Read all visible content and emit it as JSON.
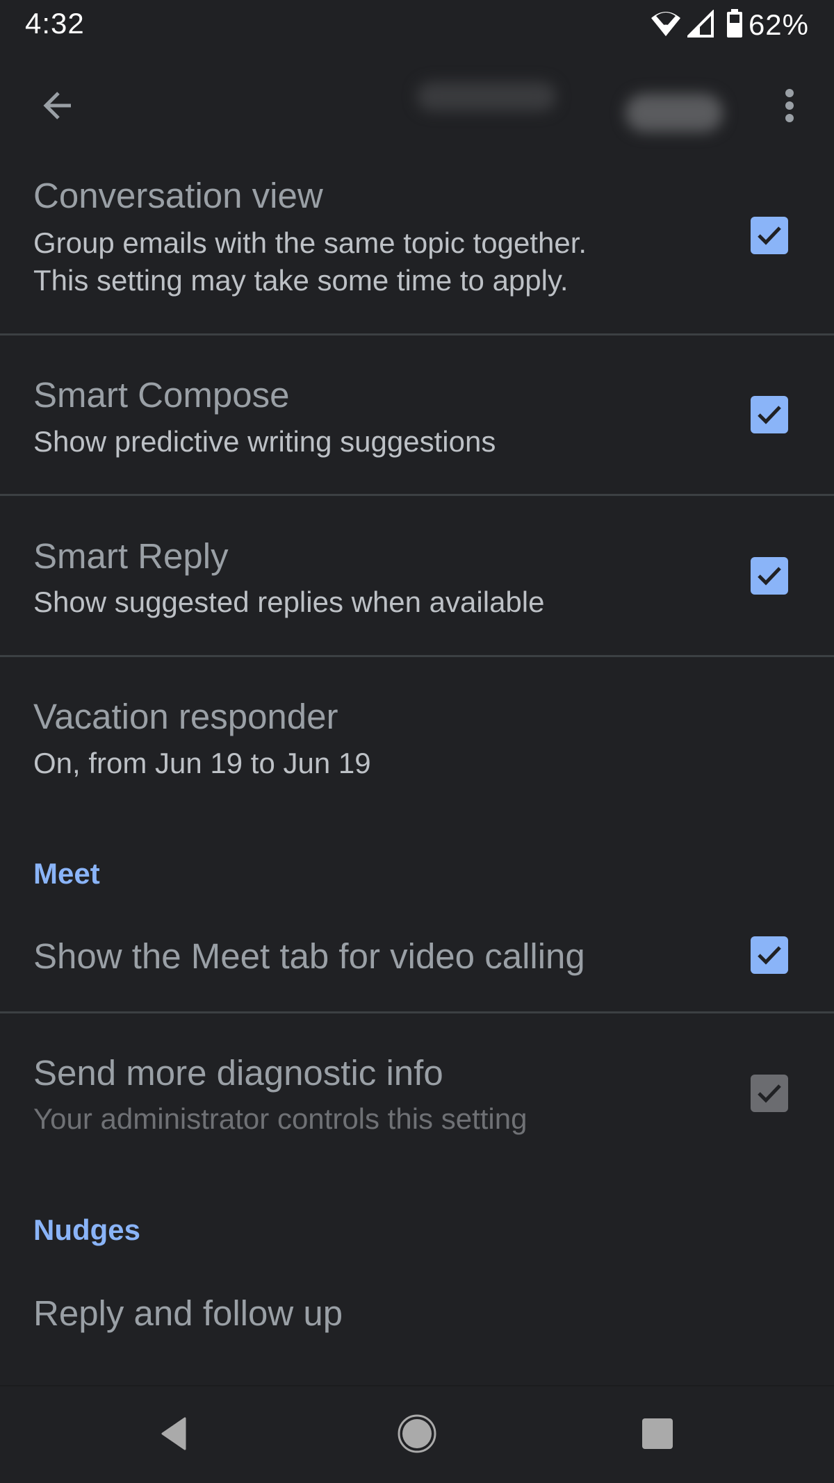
{
  "status_bar": {
    "time": "4:32",
    "battery_percent": "62%",
    "icons": [
      "wifi-icon",
      "cell-signal-icon",
      "battery-icon"
    ]
  },
  "toolbar": {
    "back_icon": "arrow-back-icon",
    "title_redacted": true,
    "more_icon": "more-vert-icon"
  },
  "colors": {
    "background": "#202124",
    "accent": "#8ab4f8",
    "title_text": "#9aa0a6",
    "subtitle_text": "#bdc1c6",
    "divider": "#3c4043",
    "disabled_checkbox": "#6b6c70"
  },
  "settings": [
    {
      "title": "Conversation view",
      "subtitle_lines": [
        "Group emails with the same topic together.",
        "This setting may take some time to apply."
      ],
      "checked": true,
      "enabled": true
    },
    {
      "title": "Smart Compose",
      "subtitle_lines": [
        "Show predictive writing suggestions"
      ],
      "checked": true,
      "enabled": true
    },
    {
      "title": "Smart Reply",
      "subtitle_lines": [
        "Show suggested replies when available"
      ],
      "checked": true,
      "enabled": true
    },
    {
      "title": "Vacation responder",
      "subtitle_lines": [
        "On, from Jun 19 to Jun 19"
      ]
    }
  ],
  "sections": [
    {
      "header": "Meet",
      "items": [
        {
          "title": "Show the Meet tab for video calling",
          "checked": true,
          "enabled": true
        },
        {
          "title": "Send more diagnostic info",
          "subtitle": "Your administrator controls this setting",
          "checked": true,
          "enabled": false
        }
      ]
    },
    {
      "header": "Nudges",
      "items": [
        {
          "title": "Reply and follow up"
        }
      ]
    }
  ],
  "nav_bar": {
    "buttons": [
      "back",
      "home",
      "recents"
    ]
  }
}
